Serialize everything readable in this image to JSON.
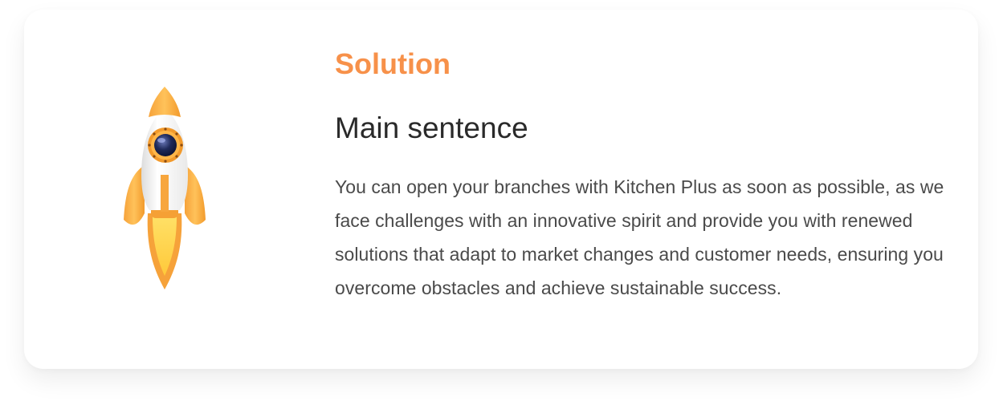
{
  "section": {
    "eyebrow": "Solution",
    "title": "Main sentence",
    "description": "You can open your branches with Kitchen Plus as soon as possible, as we face challenges with an innovative spirit and provide you with renewed solutions that adapt to market changes and customer needs, ensuring you overcome obstacles and achieve sustainable success."
  },
  "illustration": {
    "icon": "rocket-icon"
  },
  "colors": {
    "accent": "#f7914a",
    "title": "#2a2a2a",
    "body": "#4a4a4a",
    "card_background": "#ffffff"
  }
}
